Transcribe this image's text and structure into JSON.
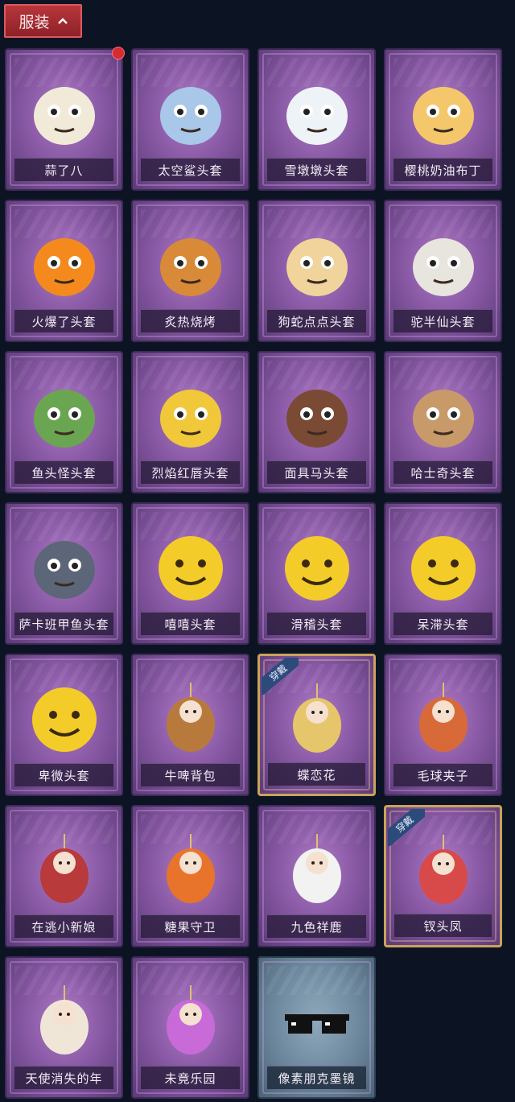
{
  "header": {
    "tab_label": "服装"
  },
  "items": [
    {
      "name": "蒜了八",
      "badge": "new-dot",
      "style": "purple",
      "icon": "garlic-head",
      "color": "#f2ead8"
    },
    {
      "name": "太空鲨头套",
      "style": "purple",
      "icon": "space-shark-head",
      "color": "#a9c7e8"
    },
    {
      "name": "雪墩墩头套",
      "style": "purple",
      "icon": "snowman-head",
      "color": "#eef3f8"
    },
    {
      "name": "樱桃奶油布丁",
      "style": "purple",
      "icon": "pudding-head",
      "color": "#f4c86a"
    },
    {
      "name": "火爆了头套",
      "style": "purple",
      "icon": "fire-head",
      "color": "#f48a1e"
    },
    {
      "name": "炙热烧烤",
      "style": "purple",
      "icon": "bbq-head",
      "color": "#d98a38"
    },
    {
      "name": "狗蛇点点头套",
      "style": "purple",
      "icon": "dog-snake-head",
      "color": "#f0d49c"
    },
    {
      "name": "驼半仙头套",
      "style": "purple",
      "icon": "bear-sunglasses-head",
      "color": "#e8e4de"
    },
    {
      "name": "鱼头怪头套",
      "style": "purple",
      "icon": "fish-head",
      "color": "#6aa651"
    },
    {
      "name": "烈焰红唇头套",
      "style": "purple",
      "icon": "pika-mask-head",
      "color": "#f0c83a"
    },
    {
      "name": "面具马头套",
      "style": "purple",
      "icon": "horse-head",
      "color": "#7a4a34"
    },
    {
      "name": "哈士奇头套",
      "style": "purple",
      "icon": "husky-head",
      "color": "#c89a6a"
    },
    {
      "name": "萨卡班甲鱼头套",
      "style": "purple",
      "icon": "fish-round-head",
      "color": "#5c6678"
    },
    {
      "name": "嘻嘻头套",
      "style": "purple",
      "icon": "grin-emoji-head",
      "color": "#f4cc2a"
    },
    {
      "name": "滑稽头套",
      "style": "purple",
      "icon": "smirk-emoji-head",
      "color": "#f4cc2a"
    },
    {
      "name": "呆滞头套",
      "style": "purple",
      "icon": "stare-emoji-head",
      "color": "#f4cc2a"
    },
    {
      "name": "卑微头套",
      "style": "purple",
      "icon": "humble-emoji-head",
      "color": "#f4cc2a"
    },
    {
      "name": "牛啤背包",
      "style": "purple",
      "icon": "beer-cow-backpack",
      "color": "#b87a3c"
    },
    {
      "name": "蝶恋花",
      "style": "gold",
      "worn": "穿戴",
      "icon": "bell-ornament",
      "color": "#e6c66a"
    },
    {
      "name": "毛球夹子",
      "style": "purple",
      "icon": "raccoon-clip",
      "color": "#d86a3a"
    },
    {
      "name": "在逃小新娘",
      "style": "purple",
      "icon": "bride-lantern",
      "color": "#b83a3a"
    },
    {
      "name": "糖果守卫",
      "style": "purple",
      "icon": "pumpkin-charm",
      "color": "#e8732a"
    },
    {
      "name": "九色祥鹿",
      "style": "purple",
      "icon": "deer-charm",
      "color": "#f2f2f2"
    },
    {
      "name": "钗头凤",
      "style": "gold",
      "worn": "穿戴",
      "icon": "phoenix-crown-doll",
      "color": "#d84a4a"
    },
    {
      "name": "天使消失的年",
      "style": "purple",
      "icon": "angel-doll",
      "color": "#f0e6d8"
    },
    {
      "name": "未竟乐园",
      "style": "purple",
      "icon": "carnival-doll",
      "color": "#c86ad8"
    },
    {
      "name": "像素朋克墨镜",
      "style": "blue",
      "icon": "pixel-sunglasses",
      "color": "#111111"
    }
  ]
}
